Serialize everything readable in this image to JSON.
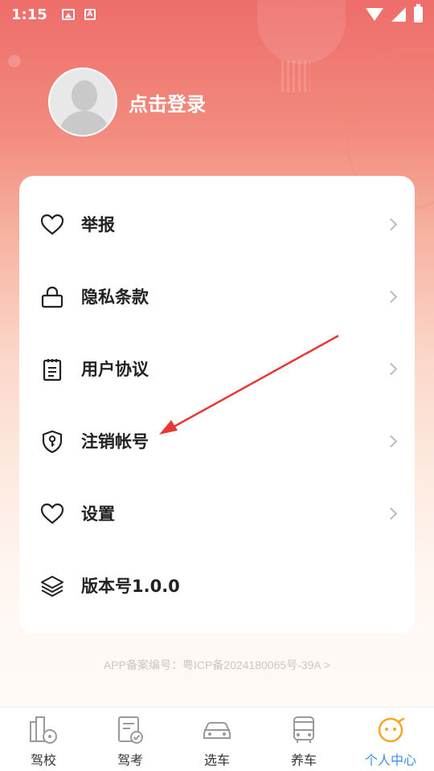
{
  "status_bar": {
    "time": "1:15",
    "small_icon_text": "A"
  },
  "profile": {
    "login_label": "点击登录"
  },
  "menu": [
    {
      "label": "举报",
      "icon": "heart-icon"
    },
    {
      "label": "隐私条款",
      "icon": "lock-icon"
    },
    {
      "label": "用户协议",
      "icon": "clipboard-icon"
    },
    {
      "label": "注销帐号",
      "icon": "shield-key-icon"
    },
    {
      "label": "设置",
      "icon": "heart-icon"
    },
    {
      "label": "版本号1.0.0",
      "icon": "layers-icon"
    }
  ],
  "icp_text": "APP备案编号：粤ICP备2024180065号-39A >",
  "tabs": [
    {
      "label": "驾校",
      "icon": "driving-school-icon",
      "active": false
    },
    {
      "label": "驾考",
      "icon": "exam-icon",
      "active": false
    },
    {
      "label": "选车",
      "icon": "car-icon",
      "active": false
    },
    {
      "label": "养车",
      "icon": "bus-icon",
      "active": false
    },
    {
      "label": "个人中心",
      "icon": "face-icon",
      "active": true
    }
  ],
  "colors": {
    "accent": "#3a8ff0",
    "arrow": "#e53935",
    "header_top": "#ee6d6b"
  }
}
